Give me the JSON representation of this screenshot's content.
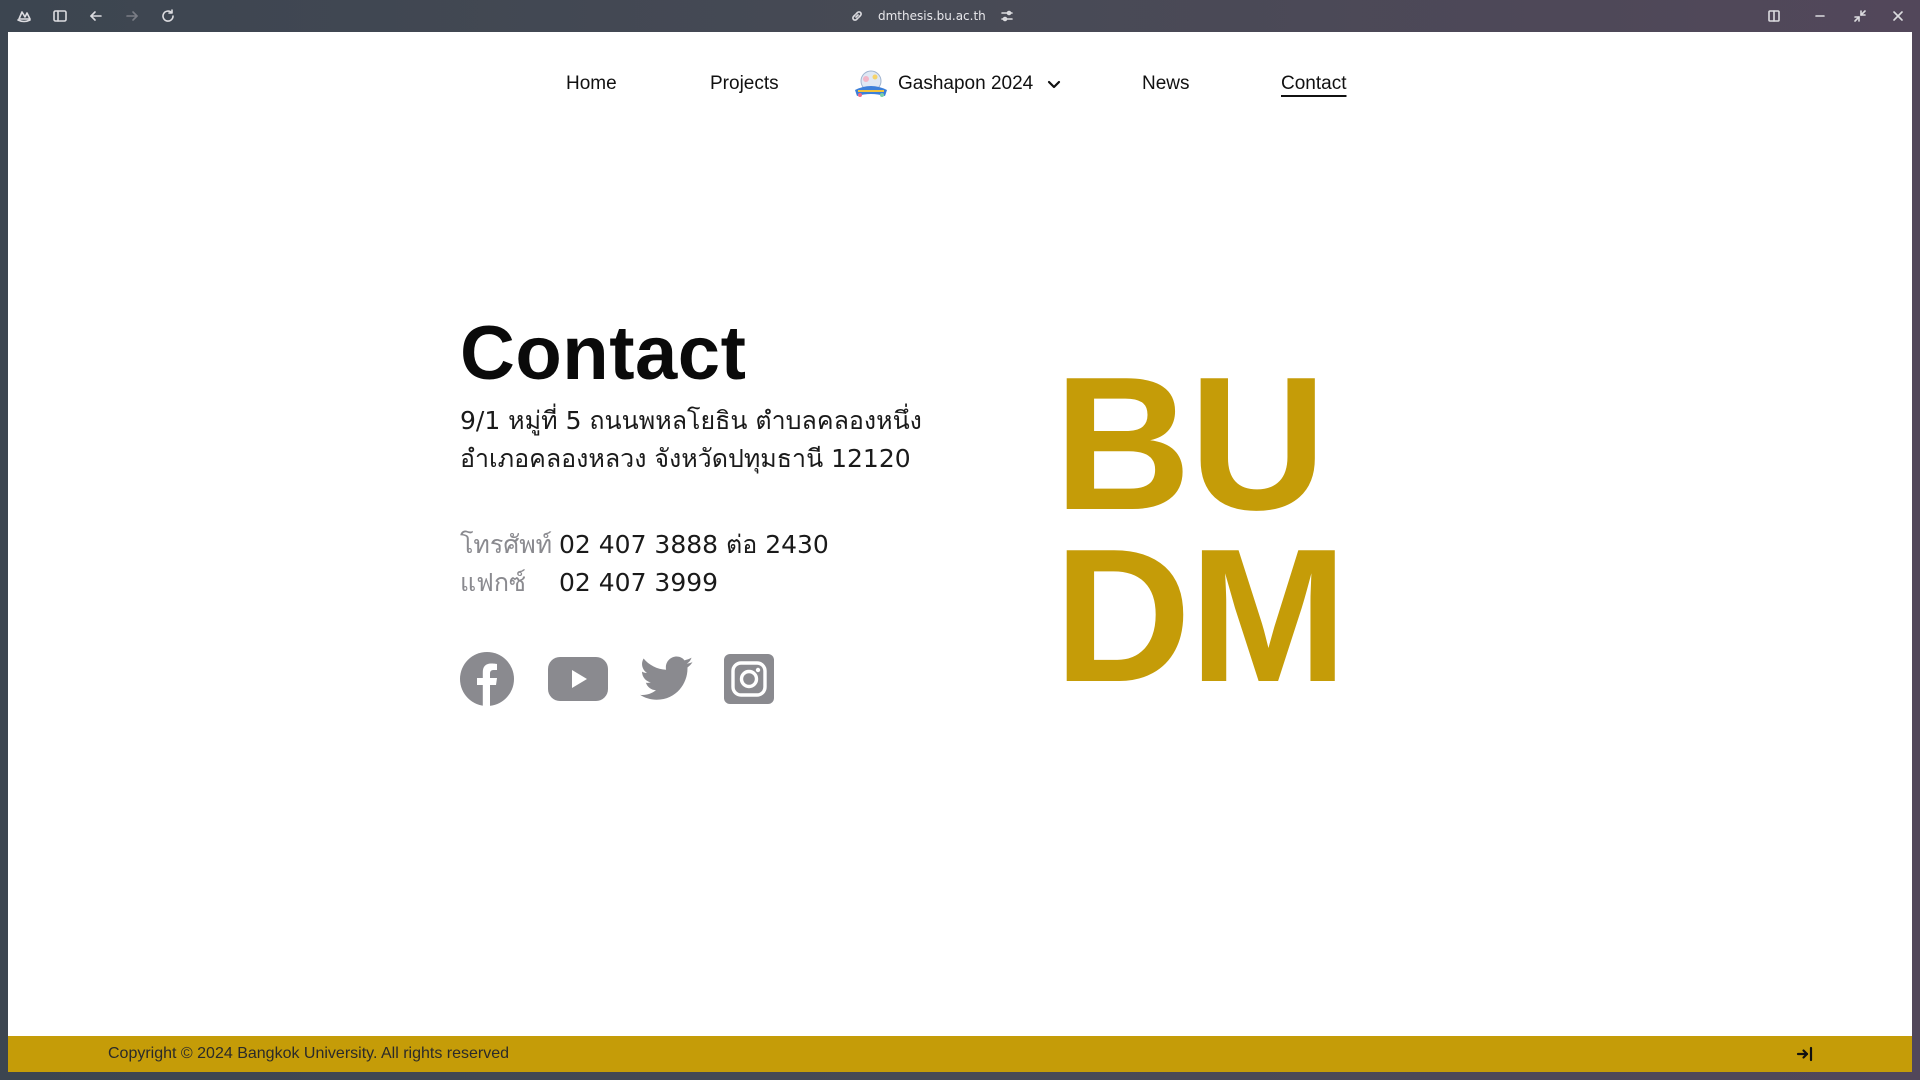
{
  "browser": {
    "url": "dmthesis.bu.ac.th",
    "icons": [
      "browser-logo-icon",
      "sidebar-toggle-icon",
      "back-icon",
      "forward-icon",
      "reload-icon",
      "link-icon",
      "site-settings-icon",
      "split-view-icon",
      "minimize-icon",
      "restore-icon",
      "close-icon"
    ]
  },
  "nav": {
    "items": [
      {
        "label": "Home"
      },
      {
        "label": "Projects"
      },
      {
        "label": "Gashapon 2024"
      },
      {
        "label": "News"
      },
      {
        "label": "Contact",
        "active": true
      }
    ]
  },
  "contact": {
    "title": "Contact",
    "address_line1": "9/1 หมู่ที่ 5 ถนนพหลโยธิน ตำบลคลองหนึ่ง",
    "address_line2": "อำเภอคลองหลวง จังหวัดปทุมธานี 12120",
    "phone_label": "โทรศัพท์",
    "phone_value": "02 407 3888 ต่อ 2430",
    "fax_label": "แฟกซ์",
    "fax_value": "02 407 3999"
  },
  "social": [
    "facebook-icon",
    "youtube-icon",
    "twitter-icon",
    "instagram-icon"
  ],
  "brand": {
    "line1": "BU",
    "line2": "DM",
    "color": "#c59c08"
  },
  "footer": {
    "copyright": "Copyright © 2024 Bangkok University. All rights reserved"
  },
  "colors": {
    "accent": "#c59c08",
    "icon_gray": "#8a8a8f"
  }
}
